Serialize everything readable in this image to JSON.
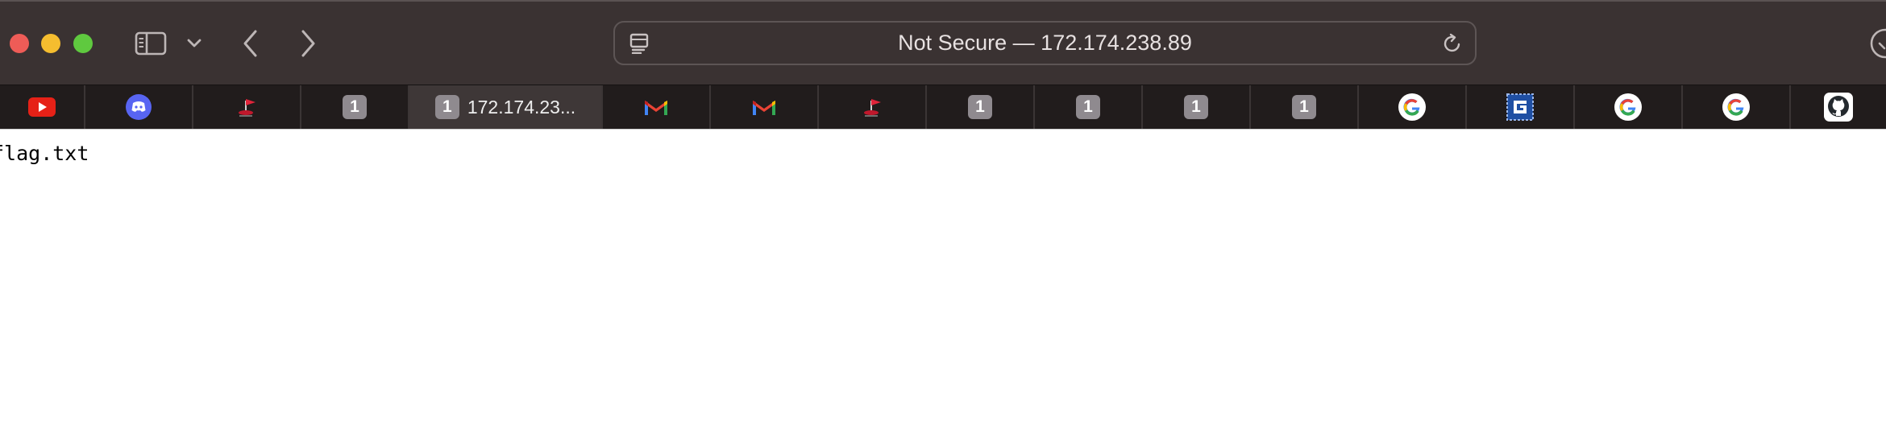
{
  "address_bar": {
    "text": "Not Secure — 172.174.238.89"
  },
  "tabs": [
    {
      "name": "tab-youtube",
      "icon": "youtube-icon",
      "label": ""
    },
    {
      "name": "tab-discord",
      "icon": "discord-icon",
      "label": ""
    },
    {
      "name": "tab-flag-site",
      "icon": "red-flag-icon",
      "label": ""
    },
    {
      "name": "tab-1",
      "icon": "number-badge-icon",
      "badge": "1",
      "label": ""
    },
    {
      "name": "tab-active",
      "icon": "number-badge-icon",
      "badge": "1",
      "label": "172.174.23..."
    },
    {
      "name": "tab-gmail-1",
      "icon": "gmail-icon",
      "label": ""
    },
    {
      "name": "tab-gmail-2",
      "icon": "gmail-icon",
      "label": ""
    },
    {
      "name": "tab-flag-site-2",
      "icon": "red-flag-icon",
      "label": ""
    },
    {
      "name": "tab-2",
      "icon": "number-badge-icon",
      "badge": "1",
      "label": ""
    },
    {
      "name": "tab-3",
      "icon": "number-badge-icon",
      "badge": "1",
      "label": ""
    },
    {
      "name": "tab-4",
      "icon": "number-badge-icon",
      "badge": "1",
      "label": ""
    },
    {
      "name": "tab-5",
      "icon": "number-badge-icon",
      "badge": "1",
      "label": ""
    },
    {
      "name": "tab-google-1",
      "icon": "google-icon",
      "label": ""
    },
    {
      "name": "tab-blue-site",
      "icon": "blue-square-icon",
      "label": ""
    },
    {
      "name": "tab-google-2",
      "icon": "google-icon",
      "label": ""
    },
    {
      "name": "tab-google-3",
      "icon": "google-icon",
      "label": ""
    },
    {
      "name": "tab-github",
      "icon": "github-icon",
      "label": ""
    }
  ],
  "content": {
    "file_entry": "flag.txt"
  },
  "colors": {
    "toolbar_bg": "#3a3232",
    "tabbar_bg": "#211c1c",
    "active_tab_bg": "#3e3737",
    "badge_gray": "#8f8a8f"
  }
}
